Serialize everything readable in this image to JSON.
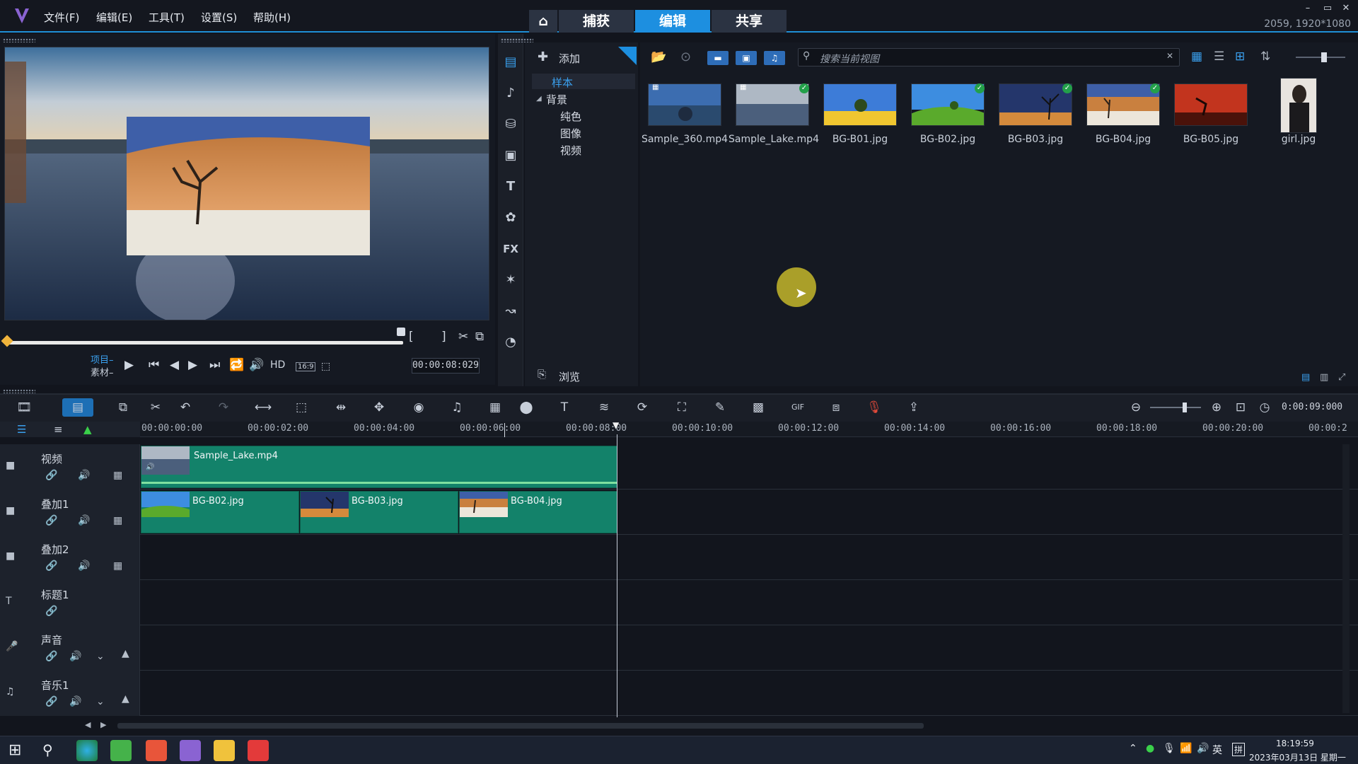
{
  "menu": [
    "文件(F)",
    "编辑(E)",
    "工具(T)",
    "设置(S)",
    "帮助(H)"
  ],
  "workspace_tabs": {
    "capture": "捕获",
    "edit": "编辑",
    "share": "共享"
  },
  "resolution_info": "2059, 1920*1080",
  "player": {
    "project_label": "项目–",
    "clip_label": "素材–",
    "hd": "HD",
    "ratio": "16:9",
    "timecode": "00:00:08:029"
  },
  "library": {
    "add_label": "添加",
    "search_placeholder": "搜索当前视图",
    "browse_label": "浏览",
    "nav": {
      "sample": "样本",
      "background": "背景",
      "solid": "纯色",
      "image": "图像",
      "video": "视频"
    },
    "thumbnails": [
      "Sample_360.mp4",
      "Sample_Lake.mp4",
      "BG-B01.jpg",
      "BG-B02.jpg",
      "BG-B03.jpg",
      "BG-B04.jpg",
      "BG-B05.jpg",
      "girl.jpg"
    ]
  },
  "timeline": {
    "duration": "0:00:09:000",
    "ruler": [
      "00:00:00:00",
      "00:00:02:00",
      "00:00:04:00",
      "00:00:06:00",
      "00:00:08:00",
      "00:00:10:00",
      "00:00:12:00",
      "00:00:14:00",
      "00:00:16:00",
      "00:00:18:00",
      "00:00:20:00",
      "00:00:2"
    ],
    "tracks": [
      "视频",
      "叠加1",
      "叠加2",
      "标题1",
      "声音",
      "音乐1"
    ],
    "clips": {
      "video": "Sample_Lake.mp4",
      "o1": "BG-B02.jpg",
      "o2": "BG-B03.jpg",
      "o3": "BG-B04.jpg"
    }
  },
  "taskbar": {
    "time": "18:19:59",
    "date": "2023年03月13日 星期一",
    "lang": "英",
    "ime": "拼"
  },
  "colors": {
    "accent": "#1d8fe0",
    "clip": "#13826a"
  }
}
